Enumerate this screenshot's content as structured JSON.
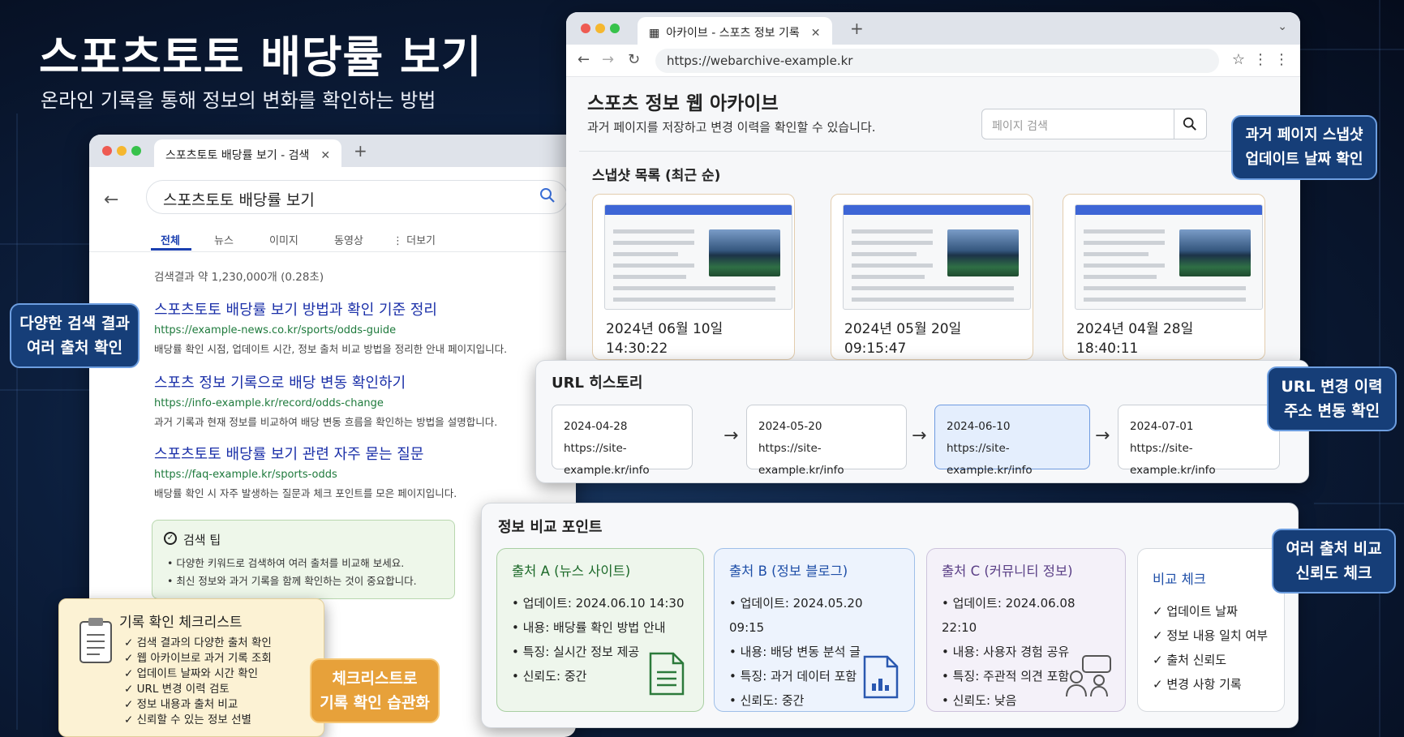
{
  "hero": {
    "title": "스포츠토토 배당률 보기",
    "subtitle": "온라인 기록을 통해 정보의 변화를 확인하는 방법"
  },
  "search_window": {
    "tab_title": "스포츠토토 배당률 보기 - 검색",
    "query": "스포츠토토 배당률 보기",
    "tabs": [
      "전체",
      "뉴스",
      "이미지",
      "동영상",
      "⋮ 더보기"
    ],
    "result_count": "검색결과 약 1,230,000개 (0.28초)",
    "results": [
      {
        "title": "스포츠토토 배당률 보기 방법과 확인 기준 정리",
        "url": "https://example-news.co.kr/sports/odds-guide",
        "desc": "배당률 확인 시점, 업데이트 시간, 정보 출처 비교 방법을 정리한 안내 페이지입니다."
      },
      {
        "title": "스포츠 정보 기록으로 배당 변동 확인하기",
        "url": "https://info-example.kr/record/odds-change",
        "desc": "과거 기록과 현재 정보를 비교하여 배당 변동 흐름을 확인하는 방법을 설명합니다."
      },
      {
        "title": "스포츠토토 배당률 보기 관련 자주 묻는 질문",
        "url": "https://faq-example.kr/sports-odds",
        "desc": "배당률 확인 시 자주 발생하는 질문과 체크 포인트를 모은 페이지입니다."
      }
    ],
    "tip": {
      "title": "검색 팁",
      "lines": [
        "• 다양한 키워드로 검색하여 여러 출처를 비교해 보세요.",
        "• 최신 정보와 과거 기록을 함께 확인하는 것이 중요합니다."
      ]
    }
  },
  "archive_window": {
    "tab_title": "아카이브 - 스포츠 정보 기록",
    "url": "https://webarchive-example.kr",
    "page_title": "스포츠 정보 웹 아카이브",
    "page_subtitle": "과거 페이지를 저장하고 변경 이력을 확인할 수 있습니다.",
    "search_placeholder": "페이지 검색",
    "snapshot_heading": "스냅샷 목록 (최근 순)",
    "snapshots": [
      {
        "date": "2024년 06월 10일",
        "time": "14:30:22"
      },
      {
        "date": "2024년 05월 20일",
        "time": "09:15:47"
      },
      {
        "date": "2024년 04월 28일",
        "time": "18:40:11"
      }
    ]
  },
  "url_history": {
    "heading": "URL 히스토리",
    "items": [
      {
        "date": "2024-04-28",
        "url": "https://site-example.kr/info"
      },
      {
        "date": "2024-05-20",
        "url": "https://site-example.kr/info"
      },
      {
        "date": "2024-06-10",
        "url": "https://site-example.kr/info"
      },
      {
        "date": "2024-07-01",
        "url": "https://site-example.kr/info"
      }
    ]
  },
  "compare": {
    "heading": "정보 비교 포인트",
    "sources": [
      {
        "title": "출처 A (뉴스 사이트)",
        "lines": [
          "• 업데이트: 2024.06.10 14:30",
          "• 내용: 배당률 확인 방법 안내",
          "• 특징: 실시간 정보 제공",
          "• 신뢰도: 중간"
        ]
      },
      {
        "title": "출처 B (정보 블로그)",
        "lines": [
          "• 업데이트: 2024.05.20 09:15",
          "• 내용: 배당 변동 분석 글",
          "• 특징: 과거 데이터 포함",
          "• 신뢰도: 중간"
        ]
      },
      {
        "title": "출처 C (커뮤니티 정보)",
        "lines": [
          "• 업데이트: 2024.06.08 22:10",
          "• 내용: 사용자 경험 공유",
          "• 특징: 주관적 의견 포함",
          "• 신뢰도: 낮음"
        ]
      }
    ],
    "check": {
      "title": "비교 체크",
      "items": [
        "✓ 업데이트 날짜",
        "✓ 정보 내용 일치 여부",
        "✓ 출처 신뢰도",
        "✓ 변경 사항 기록"
      ]
    }
  },
  "checklist": {
    "title": "기록 확인 체크리스트",
    "items": [
      "✓ 검색 결과의 다양한 출처 확인",
      "✓ 웹 아카이브로 과거 기록 조회",
      "✓ 업데이트 날짜와 시간 확인",
      "✓ URL 변경 이력 검토",
      "✓ 정보 내용과 출처 비교",
      "✓ 신뢰할 수 있는 정보 선별"
    ]
  },
  "callouts": {
    "sources": [
      "다양한 검색 결과",
      "여러 출처 확인"
    ],
    "snapshots": [
      "과거 페이지 스냅샷",
      "업데이트 날짜 확인"
    ],
    "url": [
      "URL 변경 이력",
      "주소 변동 확인"
    ],
    "compare": [
      "여러 출처 비교",
      "신뢰도 체크"
    ],
    "habit": [
      "체크리스트로",
      "기록 확인 습관화"
    ]
  }
}
